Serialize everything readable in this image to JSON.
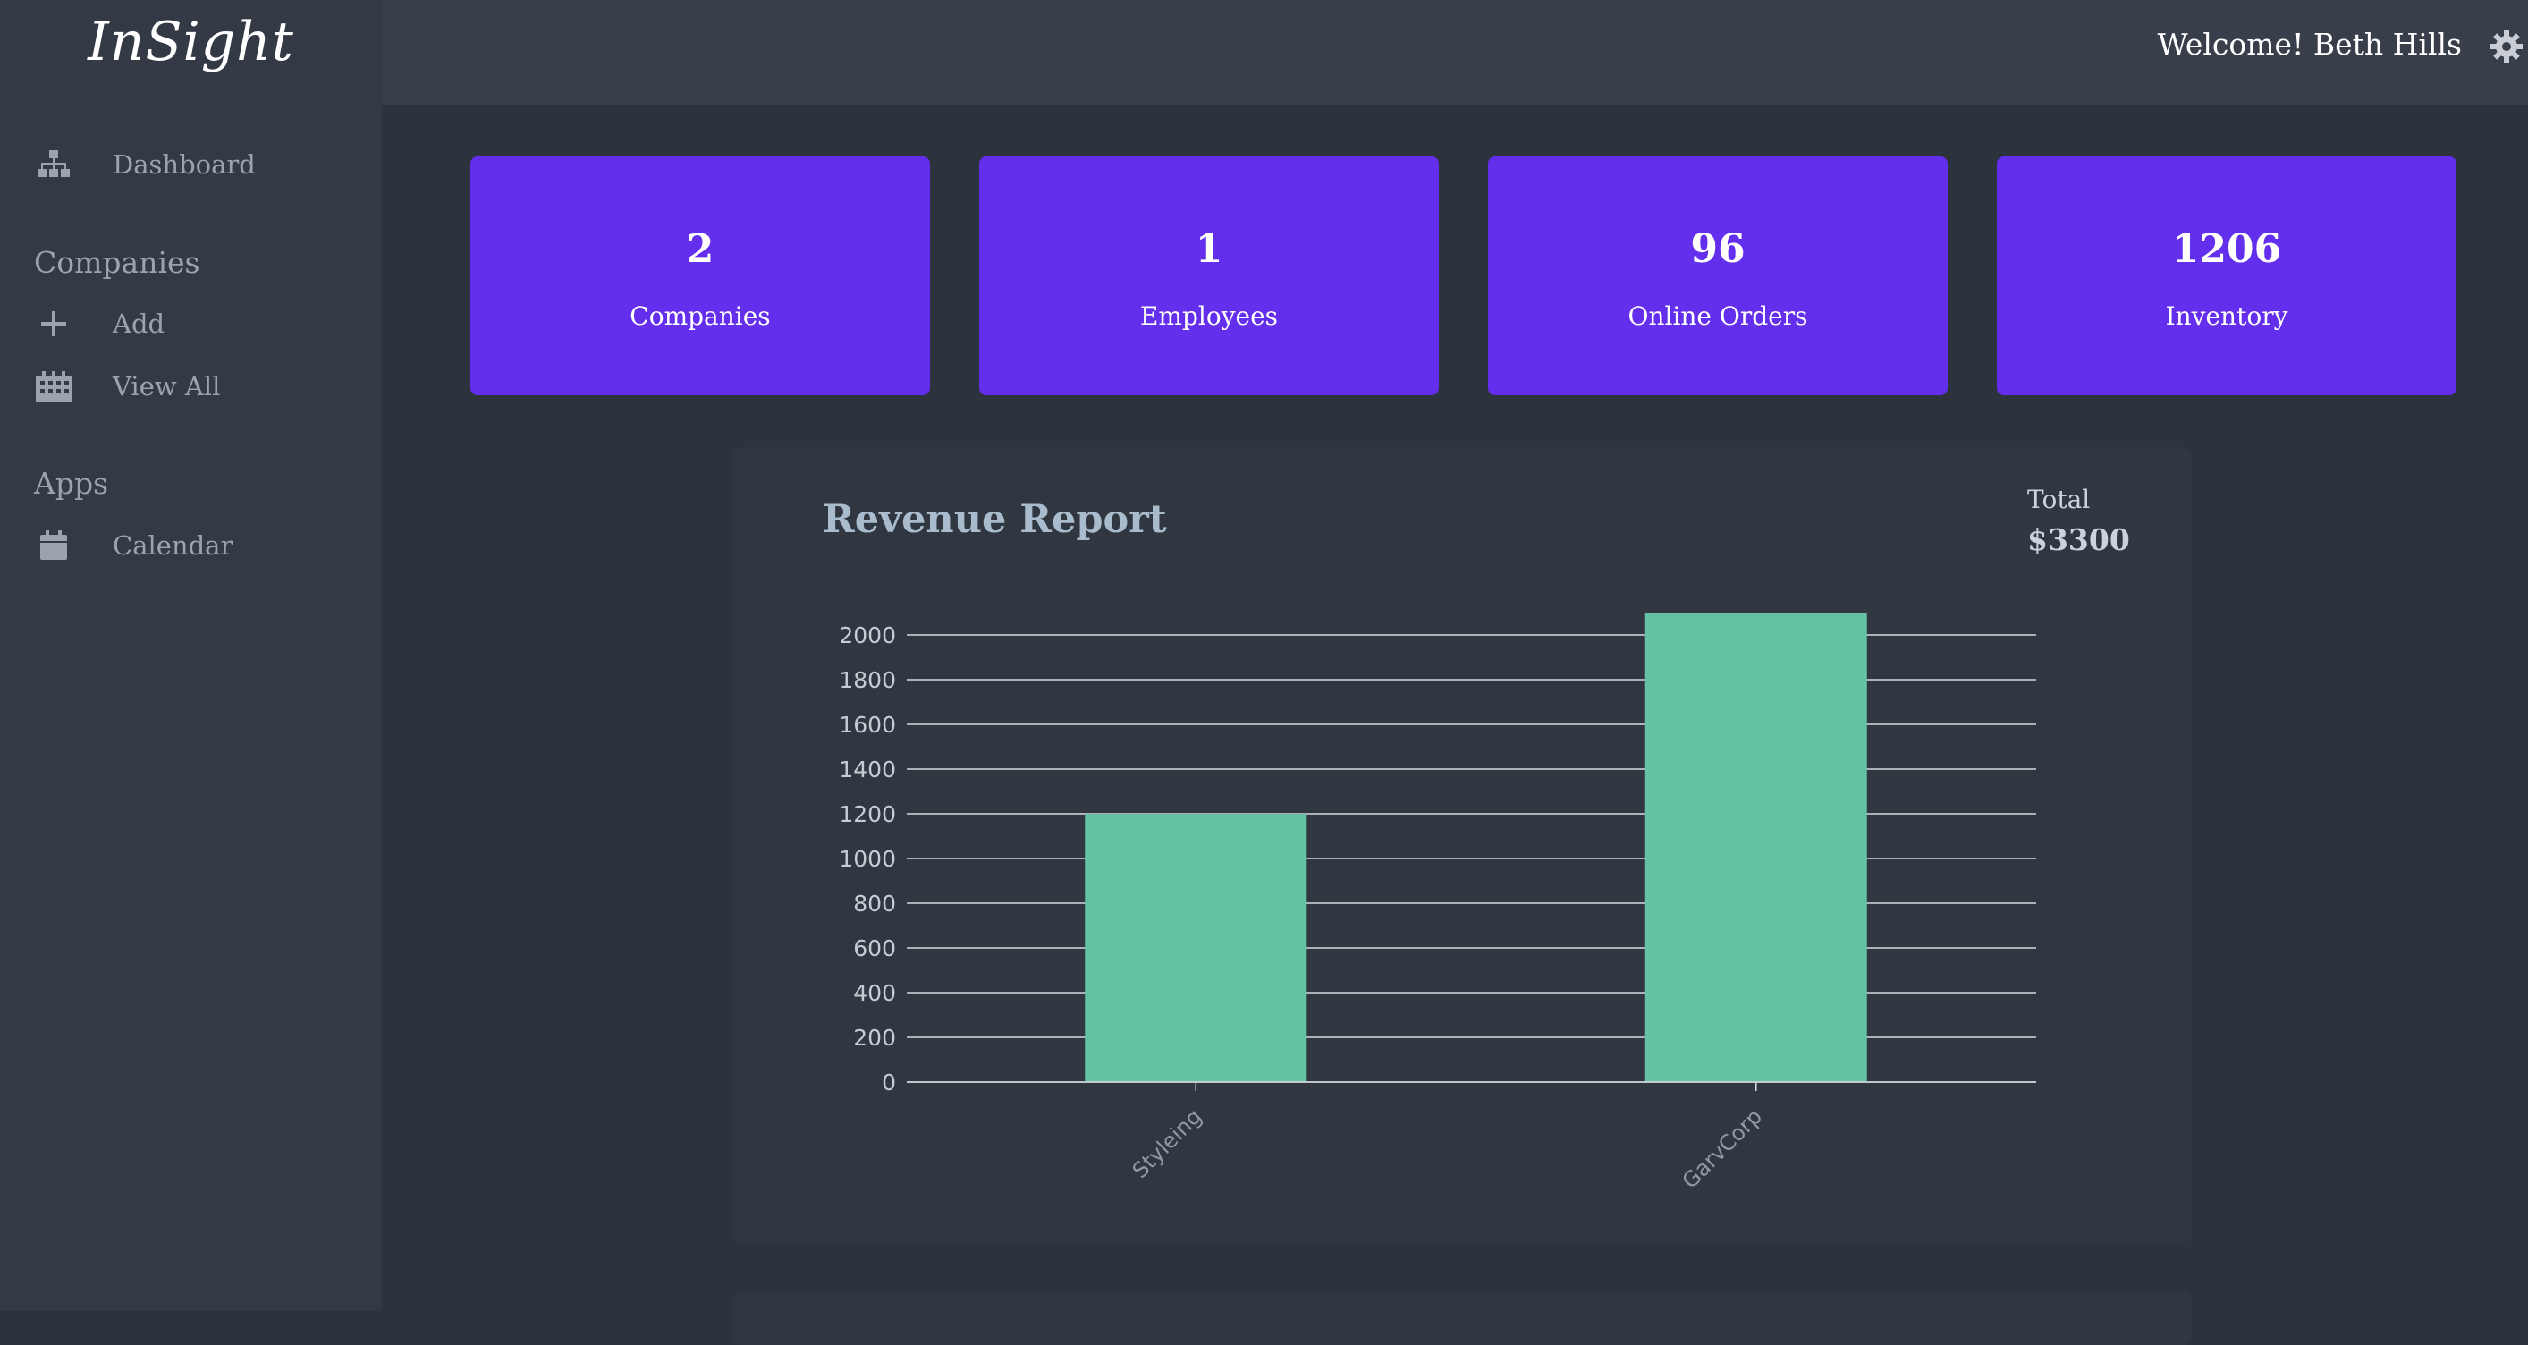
{
  "app": {
    "logo": "InSight"
  },
  "header": {
    "welcome": "Welcome! Beth Hills",
    "settings_icon": "gear-icon"
  },
  "sidebar": {
    "dashboard": {
      "label": "Dashboard",
      "icon": "sitemap-icon"
    },
    "sections": [
      {
        "title": "Companies",
        "items": [
          {
            "label": "Add",
            "icon": "plus-icon"
          },
          {
            "label": "View All",
            "icon": "building-icon"
          }
        ]
      },
      {
        "title": "Apps",
        "items": [
          {
            "label": "Calendar",
            "icon": "calendar-icon"
          }
        ]
      }
    ]
  },
  "stats": [
    {
      "value": "2",
      "label": "Companies"
    },
    {
      "value": "1",
      "label": "Employees"
    },
    {
      "value": "96",
      "label": "Online Orders"
    },
    {
      "value": "1206",
      "label": "Inventory"
    }
  ],
  "revenue": {
    "title": "Revenue Report",
    "total_label": "Total",
    "total_value": "$3300"
  },
  "colors": {
    "card": "#632fed",
    "bar": "#66c2a5",
    "background": "#2d333d",
    "sidebar": "#333a45"
  },
  "chart_data": {
    "type": "bar",
    "categories": [
      "Styleing",
      "GarvCorp"
    ],
    "values": [
      1200,
      2100
    ],
    "title": "",
    "xlabel": "",
    "ylabel": "",
    "ylim": [
      0,
      2000
    ],
    "yticks": [
      0,
      200,
      400,
      600,
      800,
      1000,
      1200,
      1400,
      1600,
      1800,
      2000
    ],
    "grid": true,
    "legend": "none"
  }
}
